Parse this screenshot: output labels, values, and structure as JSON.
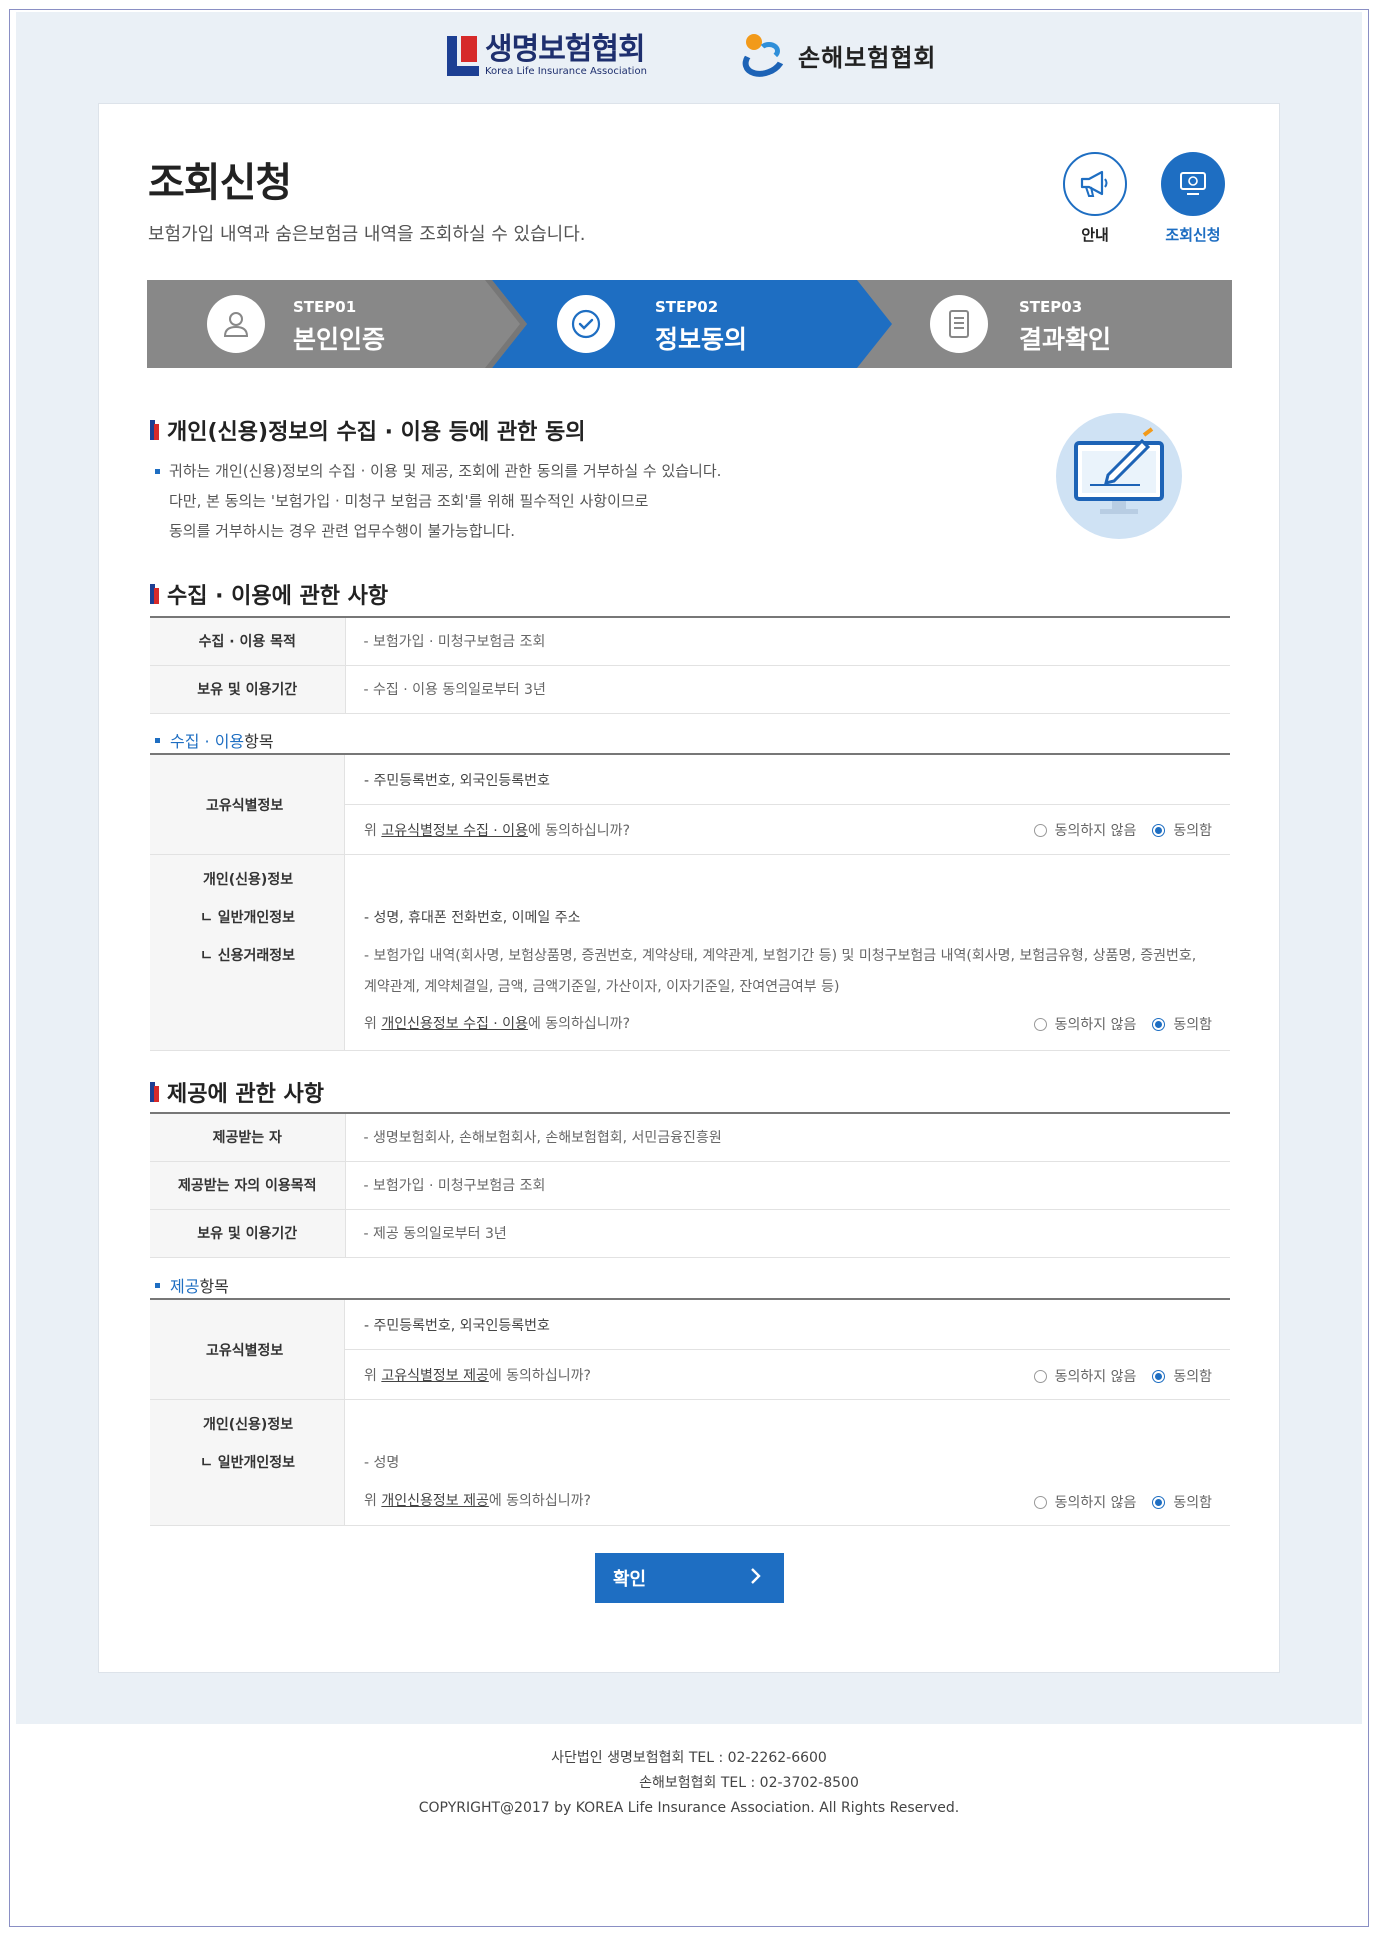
{
  "logos": {
    "life_kr": "생명보험협회",
    "life_en": "Korea Life Insurance Association",
    "nonlife_kr": "손해보험협회"
  },
  "page": {
    "title": "조회신청",
    "subtitle": "보험가입 내역과 숨은보험금 내역을 조회하실 수 있습니다."
  },
  "quick": {
    "guide_label": "안내",
    "apply_label": "조회신청"
  },
  "steps": [
    {
      "no": "STEP01",
      "name": "본인인증",
      "active": false
    },
    {
      "no": "STEP02",
      "name": "정보동의",
      "active": true
    },
    {
      "no": "STEP03",
      "name": "결과확인",
      "active": false
    }
  ],
  "consent": {
    "title": "개인(신용)정보의 수집 · 이용 등에 관한 동의",
    "lines": [
      "귀하는 개인(신용)정보의 수집 · 이용 및 제공, 조회에 관한 동의를 거부하실 수 있습니다.",
      "다만, 본 동의는 '보험가입 · 미청구 보험금 조회'를 위해 필수적인 사항이므로",
      "동의를 거부하시는 경우 관련 업무수행이 불가능합니다."
    ]
  },
  "collect": {
    "title": "수집 · 이용에 관한 사항",
    "rows": [
      {
        "k": "수집 · 이용 목적",
        "v": "- 보험가입 · 미청구보험금 조회"
      },
      {
        "k": "보유 및 이용기간",
        "v": "- 수집 · 이용 동의일로부터 3년"
      }
    ],
    "items_head_hl": "수집 · 이용",
    "items_head_rest": " 항목",
    "uid": {
      "key": "고유식별정보",
      "value": "- 주민등록번호, 외국인등록번호",
      "q_pre": "위 ",
      "q_u": "고유식별정보 수집 · 이용",
      "q_post": "에 동의하십니까?"
    },
    "personal": {
      "key1": "개인(신용)정보",
      "key2": "ㄴ 일반개인정보",
      "key3": "ㄴ 신용거래정보",
      "v1": "- 성명, 휴대폰 전화번호, 이메일 주소",
      "v2a": "- 보험가입 내역(회사명, 보험상품명, 증권번호, 계약상태, 계약관계, 보험기간 등) 및 미청구보험금 내역(회사명, 보험금유형, 상품명, 증권번호,",
      "v2b": "계약관계, 계약체결일, 금액, 금액기준일, 가산이자, 이자기준일, 잔여연금여부 등)",
      "q_pre": "위 ",
      "q_u": "개인신용정보 수집 · 이용",
      "q_post": "에 동의하십니까?"
    }
  },
  "provide": {
    "title": "제공에 관한 사항",
    "rows": [
      {
        "k": "제공받는 자",
        "v": "- 생명보험회사, 손해보험회사, 손해보험협회, 서민금융진흥원"
      },
      {
        "k": "제공받는 자의 이용목적",
        "v": "- 보험가입 · 미청구보험금 조회"
      },
      {
        "k": "보유 및 이용기간",
        "v": "- 제공 동의일로부터 3년"
      }
    ],
    "items_head_hl": "제공",
    "items_head_rest": " 항목",
    "uid": {
      "key": "고유식별정보",
      "value": "- 주민등록번호, 외국인등록번호",
      "q_pre": "위 ",
      "q_u": "고유식별정보 제공",
      "q_post": "에 동의하십니까?"
    },
    "personal": {
      "key1": "개인(신용)정보",
      "key2": "ㄴ 일반개인정보",
      "v1": "- 성명",
      "q_pre": "위 ",
      "q_u": "개인신용정보 제공",
      "q_post": "에 동의하십니까?"
    }
  },
  "radio": {
    "disagree": "동의하지 않음",
    "agree": "동의함",
    "selected": "agree"
  },
  "confirm_label": "확인",
  "footer": {
    "line1": "사단법인 생명보험협회 TEL : 02-2262-6600",
    "line2": "손해보험협회 TEL : 02-3702-8500",
    "line3": "COPYRIGHT@2017 by KOREA Life Insurance Association. All Rights Reserved."
  },
  "colors": {
    "accent": "#1e6ec2",
    "step_inactive": "#888888",
    "page_bg": "#eaf0f6"
  }
}
